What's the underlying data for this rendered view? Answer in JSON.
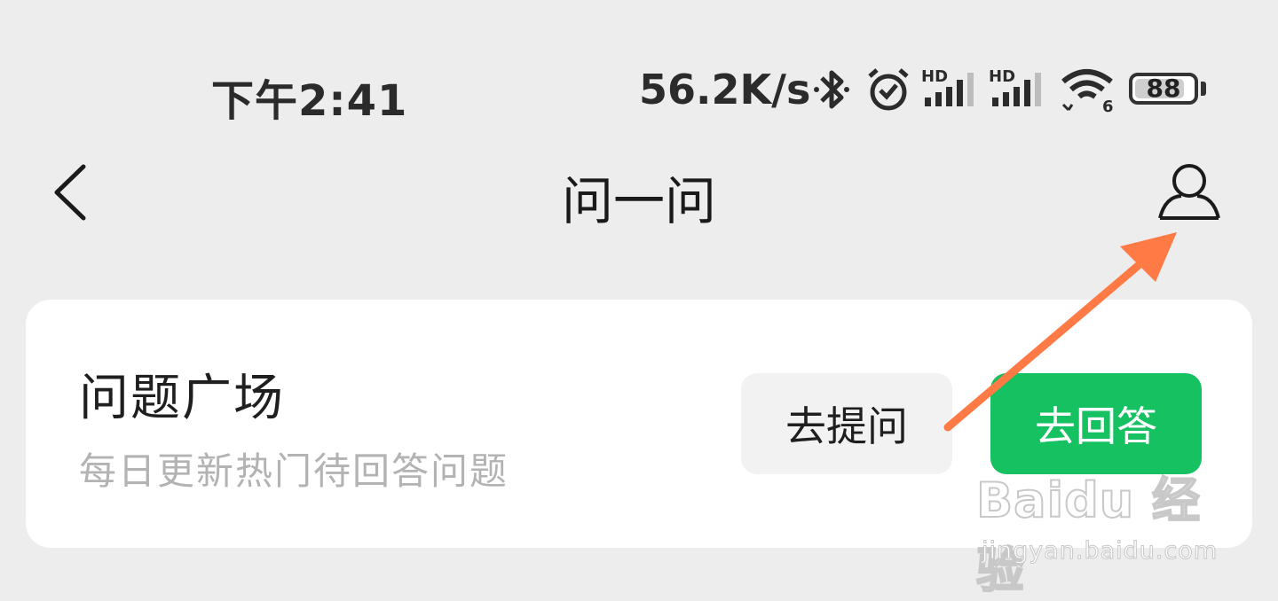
{
  "status_bar": {
    "time": "下午2:41",
    "network_speed": "56.2K/s",
    "battery": "88",
    "hd_label": "HD",
    "wifi_label": "6",
    "icons": [
      "bluetooth-icon",
      "alarm-icon",
      "signal-hd-icon",
      "signal-hd-icon",
      "wifi-6-icon",
      "battery-icon"
    ]
  },
  "nav": {
    "title": "问一问",
    "back_icon": "chevron-left-icon",
    "profile_icon": "user-profile-icon"
  },
  "card": {
    "title": "问题广场",
    "subtitle": "每日更新热门待回答问题",
    "ask_button": "去提问",
    "answer_button": "去回答"
  },
  "watermark": {
    "brand": "Baidu 经验",
    "url": "jingyan.baidu.com"
  },
  "colors": {
    "background": "#ededed",
    "accent_green": "#15c160",
    "annotation_arrow": "#ff7a45"
  }
}
